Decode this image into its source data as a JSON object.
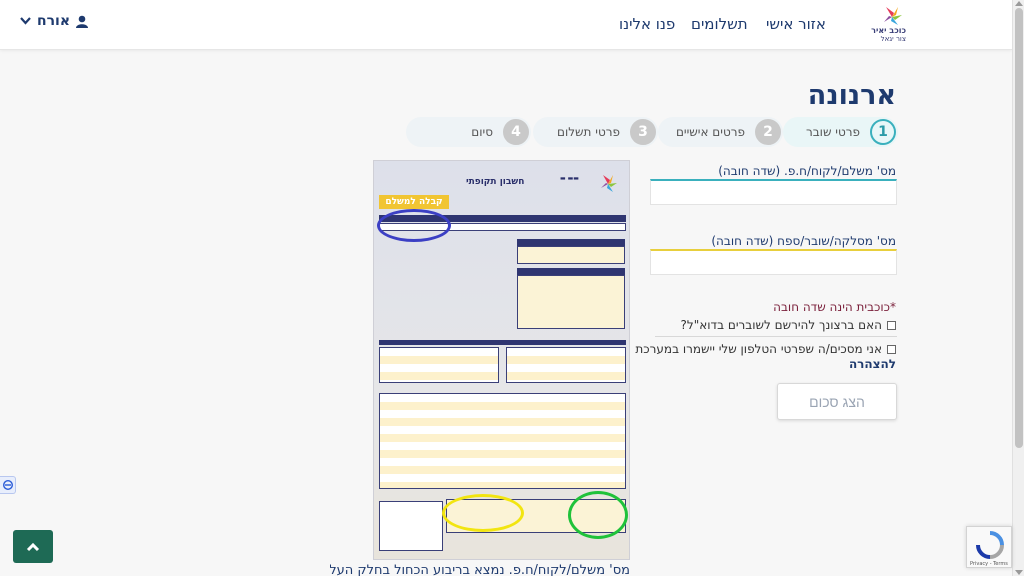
{
  "header": {
    "nav": [
      {
        "label": "אזור אישי"
      },
      {
        "label": "תשלומים"
      },
      {
        "label": "פנו אלינו"
      }
    ],
    "user_label": "אורח",
    "logo_text_top": "כוכב יאיר",
    "logo_text_bottom": "צור יגאל"
  },
  "page": {
    "title": "ארנונה"
  },
  "steps": [
    {
      "num": "1",
      "label": "פרטי שובר",
      "active": true
    },
    {
      "num": "2",
      "label": "פרטים אישיים",
      "active": false
    },
    {
      "num": "3",
      "label": "פרטי תשלום",
      "active": false
    },
    {
      "num": "4",
      "label": "סיום",
      "active": false
    }
  ],
  "form": {
    "payer_label": "מס' משלם/לקוח/ח.פ. (שדה חובה)",
    "parcel_label": "מס' מסלקה/שובר/ספח (שדה חובה)",
    "required_note": "*כוכבית הינה שדה חובה",
    "email_checkbox": "האם ברצונך להירשם לשוברים בדוא\"ל?",
    "phone_consent": "אני מסכים/ה שפרטי הטלפון שלי יישמרו במערכת",
    "consent_link": "להצהרה",
    "submit_label": "הצג סכום"
  },
  "bill": {
    "title": "חשבון תקופתי",
    "stamp": "קבלה למשלם"
  },
  "bill_caption": "מס' משלם/לקוח/ח.פ. נמצא בריבוע הכחול בחלק העליון",
  "recaptcha": {
    "footer": "Privacy - Terms"
  },
  "colors": {
    "brand": "#1e3a6e",
    "accent": "#3ab0bd",
    "back_to_top": "#1e6a55"
  }
}
